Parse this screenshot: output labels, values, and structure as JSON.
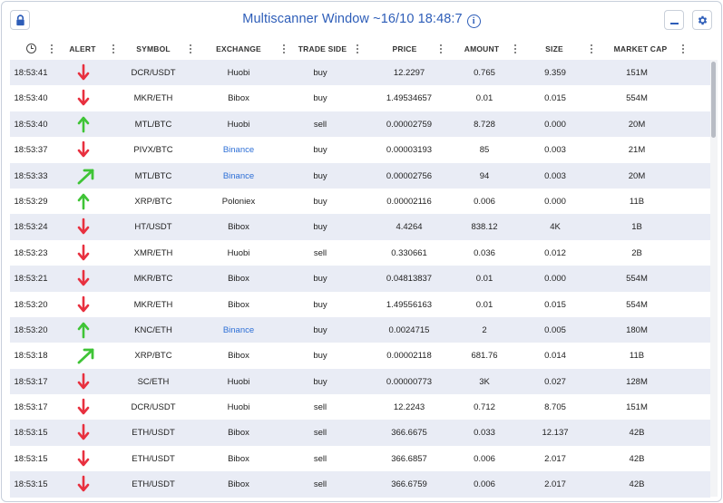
{
  "window": {
    "title": "Multiscanner Window ~16/10 18:48:7",
    "info_symbol": "i"
  },
  "colors": {
    "accent": "#2d5db8",
    "arrow_down": "#e8303f",
    "arrow_up": "#3fc436",
    "binance": "#2d6fd6",
    "row_alt": "#e9ecf5"
  },
  "icons": {
    "lock": "lock-icon",
    "minimize": "minimize-icon",
    "settings": "gear-icon",
    "time_column": "clock-icon",
    "column_menu": "vertical-dots-icon"
  },
  "columns": [
    "ALERT",
    "SYMBOL",
    "EXCHANGE",
    "TRADE SIDE",
    "PRICE",
    "AMOUNT",
    "SIZE",
    "MARKET CAP"
  ],
  "rows": [
    {
      "time": "18:53:41",
      "alert": "down",
      "symbol": "DCR/USDT",
      "exchange": "Huobi",
      "side": "buy",
      "price": "12.2297",
      "amount": "0.765",
      "size": "9.359",
      "mcap": "151M"
    },
    {
      "time": "18:53:40",
      "alert": "down",
      "symbol": "MKR/ETH",
      "exchange": "Bibox",
      "side": "buy",
      "price": "1.49534657",
      "amount": "0.01",
      "size": "0.015",
      "mcap": "554M"
    },
    {
      "time": "18:53:40",
      "alert": "up",
      "symbol": "MTL/BTC",
      "exchange": "Huobi",
      "side": "sell",
      "price": "0.00002759",
      "amount": "8.728",
      "size": "0.000",
      "mcap": "20M"
    },
    {
      "time": "18:53:37",
      "alert": "down",
      "symbol": "PIVX/BTC",
      "exchange": "Binance",
      "side": "buy",
      "price": "0.00003193",
      "amount": "85",
      "size": "0.003",
      "mcap": "21M"
    },
    {
      "time": "18:53:33",
      "alert": "diag",
      "symbol": "MTL/BTC",
      "exchange": "Binance",
      "side": "buy",
      "price": "0.00002756",
      "amount": "94",
      "size": "0.003",
      "mcap": "20M"
    },
    {
      "time": "18:53:29",
      "alert": "up",
      "symbol": "XRP/BTC",
      "exchange": "Poloniex",
      "side": "buy",
      "price": "0.00002116",
      "amount": "0.006",
      "size": "0.000",
      "mcap": "11B"
    },
    {
      "time": "18:53:24",
      "alert": "down",
      "symbol": "HT/USDT",
      "exchange": "Bibox",
      "side": "buy",
      "price": "4.4264",
      "amount": "838.12",
      "size": "4K",
      "mcap": "1B"
    },
    {
      "time": "18:53:23",
      "alert": "down",
      "symbol": "XMR/ETH",
      "exchange": "Huobi",
      "side": "sell",
      "price": "0.330661",
      "amount": "0.036",
      "size": "0.012",
      "mcap": "2B"
    },
    {
      "time": "18:53:21",
      "alert": "down",
      "symbol": "MKR/BTC",
      "exchange": "Bibox",
      "side": "buy",
      "price": "0.04813837",
      "amount": "0.01",
      "size": "0.000",
      "mcap": "554M"
    },
    {
      "time": "18:53:20",
      "alert": "down",
      "symbol": "MKR/ETH",
      "exchange": "Bibox",
      "side": "buy",
      "price": "1.49556163",
      "amount": "0.01",
      "size": "0.015",
      "mcap": "554M"
    },
    {
      "time": "18:53:20",
      "alert": "up",
      "symbol": "KNC/ETH",
      "exchange": "Binance",
      "side": "buy",
      "price": "0.0024715",
      "amount": "2",
      "size": "0.005",
      "mcap": "180M"
    },
    {
      "time": "18:53:18",
      "alert": "diag",
      "symbol": "XRP/BTC",
      "exchange": "Bibox",
      "side": "buy",
      "price": "0.00002118",
      "amount": "681.76",
      "size": "0.014",
      "mcap": "11B"
    },
    {
      "time": "18:53:17",
      "alert": "down",
      "symbol": "SC/ETH",
      "exchange": "Huobi",
      "side": "buy",
      "price": "0.00000773",
      "amount": "3K",
      "size": "0.027",
      "mcap": "128M"
    },
    {
      "time": "18:53:17",
      "alert": "down",
      "symbol": "DCR/USDT",
      "exchange": "Huobi",
      "side": "sell",
      "price": "12.2243",
      "amount": "0.712",
      "size": "8.705",
      "mcap": "151M"
    },
    {
      "time": "18:53:15",
      "alert": "down",
      "symbol": "ETH/USDT",
      "exchange": "Bibox",
      "side": "sell",
      "price": "366.6675",
      "amount": "0.033",
      "size": "12.137",
      "mcap": "42B"
    },
    {
      "time": "18:53:15",
      "alert": "down",
      "symbol": "ETH/USDT",
      "exchange": "Bibox",
      "side": "sell",
      "price": "366.6857",
      "amount": "0.006",
      "size": "2.017",
      "mcap": "42B"
    },
    {
      "time": "18:53:15",
      "alert": "down",
      "symbol": "ETH/USDT",
      "exchange": "Bibox",
      "side": "sell",
      "price": "366.6759",
      "amount": "0.006",
      "size": "2.017",
      "mcap": "42B"
    }
  ]
}
